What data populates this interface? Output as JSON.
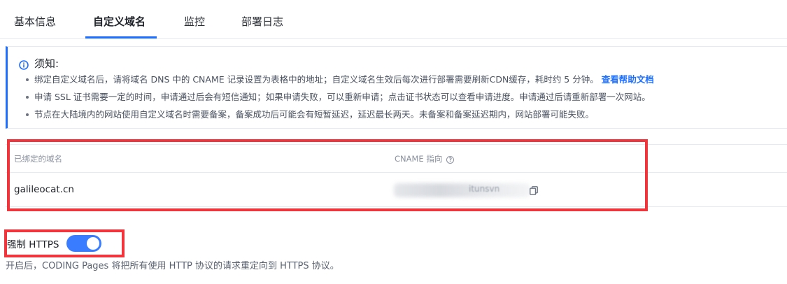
{
  "tabs": [
    {
      "label": "基本信息"
    },
    {
      "label": "自定义域名"
    },
    {
      "label": "监控"
    },
    {
      "label": "部署日志"
    }
  ],
  "notice": {
    "title": "须知:",
    "icon": "info-icon",
    "items": [
      "绑定自定义域名后，请将域名 DNS 中的 CNAME 记录设置为表格中的地址；自定义域名生效后每次进行部署需要刷新CDN缓存，耗时约 5 分钟。",
      "申请 SSL 证书需要一定的时间，申请通过后会有短信通知；如果申请失败，可以重新申请；点击证书状态可以查看申请进度。申请通过后请重新部署一次网站。",
      "节点在大陆境内的网站使用自定义域名时需要备案，备案成功后可能会有短暂延迟，延迟最长两天。未备案和备案延迟期内，网站部署可能失败。"
    ],
    "help_link": "查看帮助文档"
  },
  "domain_table": {
    "col_domain": "已绑定的域名",
    "col_cname": "CNAME 指向",
    "rows": [
      {
        "domain": "galileocat.cn",
        "cname_visible_fragment": "itunsvn"
      }
    ]
  },
  "https": {
    "label": "强制 HTTPS",
    "enabled": true,
    "description": "开启后，CODING Pages 将把所有使用 HTTP 协议的请求重定向到 HTTPS 协议。"
  },
  "colors": {
    "accent": "#1e6fff",
    "highlight_red": "#f0363c",
    "toggle_on": "#3a7cff"
  }
}
